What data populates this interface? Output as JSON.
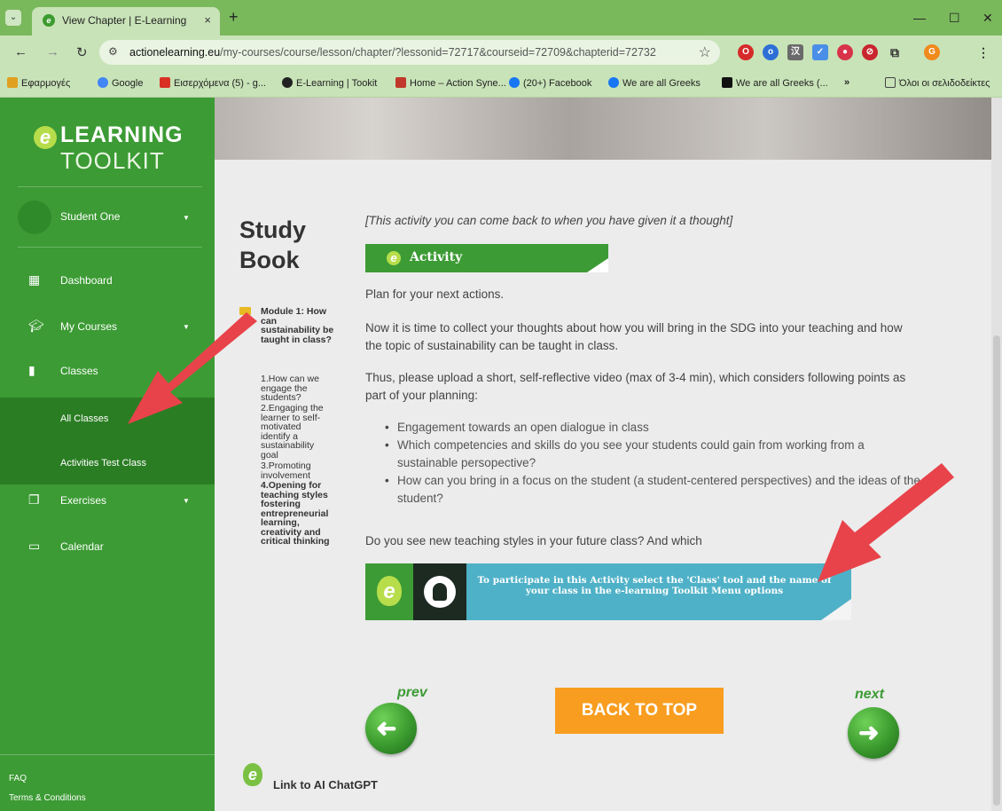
{
  "browser": {
    "tab_title": "View Chapter | E-Learning",
    "tab_close": "×",
    "new_tab": "+",
    "url_host": "actionelearning.eu",
    "url_path": "/my-courses/course/lesson/chapter/?lessonid=72717&courseid=72709&chapterid=72732",
    "bookmarks": [
      "Εφαρμογές",
      "Google",
      "Εισερχόμενα (5) - g...",
      "E-Learning | Tookit",
      "Home – Action Syne...",
      "(20+) Facebook",
      "We are all Greeks",
      "We are all Greeks (...",
      "»",
      "Όλοι οι σελιδοδείκτες"
    ]
  },
  "sidebar": {
    "logo_line1": "LEARNING",
    "logo_line2": "TOOLKIT",
    "logo_e": "e",
    "user_name": "Student One",
    "items": [
      {
        "label": "Dashboard",
        "icon": "dashboard-icon"
      },
      {
        "label": "My Courses",
        "icon": "graduation-cap-icon"
      },
      {
        "label": "Classes",
        "icon": "book-icon"
      },
      {
        "label": "Exercises",
        "icon": "files-icon"
      },
      {
        "label": "Calendar",
        "icon": "calendar-icon"
      }
    ],
    "sub_items": [
      "All Classes",
      "Activities Test Class"
    ],
    "footer": [
      "FAQ",
      "Terms & Conditions"
    ]
  },
  "content": {
    "study_title_1": "Study",
    "study_title_2": "Book",
    "toc": {
      "module": [
        "Module 1: How",
        "can",
        "sustainability be",
        "taught in class?"
      ],
      "items": [
        [
          "1.How can we",
          "engage the",
          "students?"
        ],
        [
          "2.Engaging the",
          "learner to self-",
          "motivated",
          "identify a",
          "sustainability",
          "goal"
        ],
        [
          "3.Promoting",
          "involvement"
        ]
      ],
      "active": [
        "4.Opening for",
        "teaching styles",
        "fostering",
        "entrepreneurial",
        "learning,",
        "creativity and",
        "critical thinking"
      ]
    },
    "note": "[This activity you can come back to when you have given it a thought]",
    "activity_label": "Activity",
    "p1": "Plan for your next actions.",
    "p2": "Now it is time to collect your thoughts about how you will bring in the SDG into your teaching and how the topic of sustainability can be taught in class.",
    "p3": "Thus, please upload a short, self-reflective video (max of 3-4 min), which considers following points as part of your planning:",
    "bullets": [
      "Engagement towards an open dialogue in class",
      "Which competencies and skills do you see your students could gain from working from a sustainable persopective?",
      "How can you bring in a focus on the student (a student-centered perspectives) and the ideas of the student?"
    ],
    "p4": "Do you see new teaching styles in your future class? And which",
    "class_banner_text": "To participate in this Activity select the 'Class' tool and the name of your class in the e-learning Toolkit Menu options",
    "prev_label": "prev",
    "next_label": "next",
    "back_to_top": "BACK TO TOP",
    "chat_link": "Link to AI ChatGPT"
  },
  "colors": {
    "sidebar": "#3c9b34",
    "sidebar_active": "#2b7d24",
    "back_to_top": "#f89d1f",
    "arrow": "#e8434a"
  }
}
